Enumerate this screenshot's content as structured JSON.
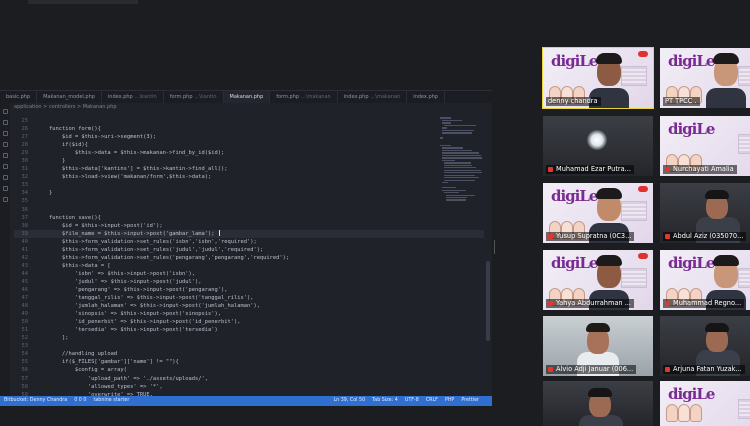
{
  "editor": {
    "tabs": [
      {
        "label": "basic.php"
      },
      {
        "label": "Makanan_model.php"
      },
      {
        "label": "index.php",
        "hint": "...\\kantin"
      },
      {
        "label": "form.php",
        "hint": "...\\kantin"
      },
      {
        "label": "Makanan.php",
        "active": true
      },
      {
        "label": "form.php",
        "hint": "...\\makanan"
      },
      {
        "label": "index.php",
        "hint": "...\\makanan"
      },
      {
        "label": "index.php"
      }
    ],
    "breadcrumb": "application > controllers > Makanan.php",
    "lines": [
      {
        "n": "25",
        "t": ""
      },
      {
        "n": "26",
        "t": "    function form(){"
      },
      {
        "n": "27",
        "t": "        $id = $this->uri->segment(3);"
      },
      {
        "n": "28",
        "t": "        if($id){"
      },
      {
        "n": "29",
        "t": "            $this->data = $this->makanan->find_by_id($id);"
      },
      {
        "n": "30",
        "t": "        }"
      },
      {
        "n": "31",
        "t": "        $this->data['kantins'] = $this->kantin->find_all();"
      },
      {
        "n": "32",
        "t": "        $this->load->view('makanan/form',$this->data);"
      },
      {
        "n": "33",
        "t": ""
      },
      {
        "n": "34",
        "t": "    }"
      },
      {
        "n": "35",
        "t": ""
      },
      {
        "n": "36",
        "t": ""
      },
      {
        "n": "37",
        "t": "    function save(){"
      },
      {
        "n": "38",
        "t": "        $id = $this->input->post('id');"
      },
      {
        "n": "39",
        "t": "        $file_name = $this->input->post('gambar_lama');",
        "current": true
      },
      {
        "n": "40",
        "t": "        $this->form_validation->set_rules('isbn','isbn','required');"
      },
      {
        "n": "41",
        "t": "        $this->form_validation->set_rules('judul','judul','required');"
      },
      {
        "n": "42",
        "t": "        $this->form_validation->set_rules('pengarang','pengarang','required');"
      },
      {
        "n": "43",
        "t": "        $this->data = ["
      },
      {
        "n": "44",
        "t": "            'isbn' => $this->input->post('isbn'),"
      },
      {
        "n": "45",
        "t": "            'judul' => $this->input->post('judul'),"
      },
      {
        "n": "46",
        "t": "            'pengarang' => $this->input->post('pengarang'),"
      },
      {
        "n": "47",
        "t": "            'tanggal_rilis' => $this->input->post('tanggal_rilis'),"
      },
      {
        "n": "48",
        "t": "            'jumlah_halaman' => $this->input->post('jumlah_halaman'),"
      },
      {
        "n": "49",
        "t": "            'sinopsis' => $this->input->post('sinopsis'),"
      },
      {
        "n": "50",
        "t": "            'id_penerbit' => $this->input->post('id_penerbit'),"
      },
      {
        "n": "51",
        "t": "            'tersedia' => $this->input->post('tersedia')"
      },
      {
        "n": "52",
        "t": "        ];"
      },
      {
        "n": "53",
        "t": ""
      },
      {
        "n": "54",
        "t": "        //handling upload"
      },
      {
        "n": "55",
        "t": "        if($_FILES['gambar']['name'] != \"\"){"
      },
      {
        "n": "56",
        "t": "            $config = array("
      },
      {
        "n": "57",
        "t": "                'upload_path' => './assets/uploads/',"
      },
      {
        "n": "58",
        "t": "                'allowed_types' => '*',"
      },
      {
        "n": "59",
        "t": "                'overwrite' => TRUE,"
      }
    ],
    "status_left": [
      "Bitbucket: Denny Chandra",
      "0  0  0",
      "tabnine starter"
    ],
    "status_right": [
      "Ln 39, Col 50",
      "Tab Size: 4",
      "UTF-8",
      "CRLF",
      "PHP",
      "Prettier"
    ]
  },
  "tiles": [
    {
      "name": "denny chandra",
      "selected": true,
      "scene": "pink-person"
    },
    {
      "name": "PT TPCC .",
      "scene": "pink-person"
    },
    {
      "name": "Muhamad Ezar Putra...",
      "scene": "lamp"
    },
    {
      "name": "Nurchayati Amalia",
      "scene": "pink"
    },
    {
      "name": "Yusup Supratna (0C3...",
      "scene": "pink-person"
    },
    {
      "name": "Abdul Aziz (035070...",
      "scene": "dark-person"
    },
    {
      "name": "Yahya Abdurrahman ...",
      "scene": "pink-person"
    },
    {
      "name": "Muhammad Regno...",
      "scene": "pink-person"
    },
    {
      "name": "Alvio Adji Januar (006...",
      "scene": "room"
    },
    {
      "name": "Arjuna Fatan Yuzak...",
      "scene": "dark-person"
    },
    {
      "name": "",
      "scene": "dark-person"
    },
    {
      "name": "",
      "scene": "pink"
    }
  ],
  "branding": {
    "logo_text": "digiLe",
    "accent": "#7a2a93",
    "status_color": "#2e6fd0",
    "mic_color": "#e2362f"
  }
}
